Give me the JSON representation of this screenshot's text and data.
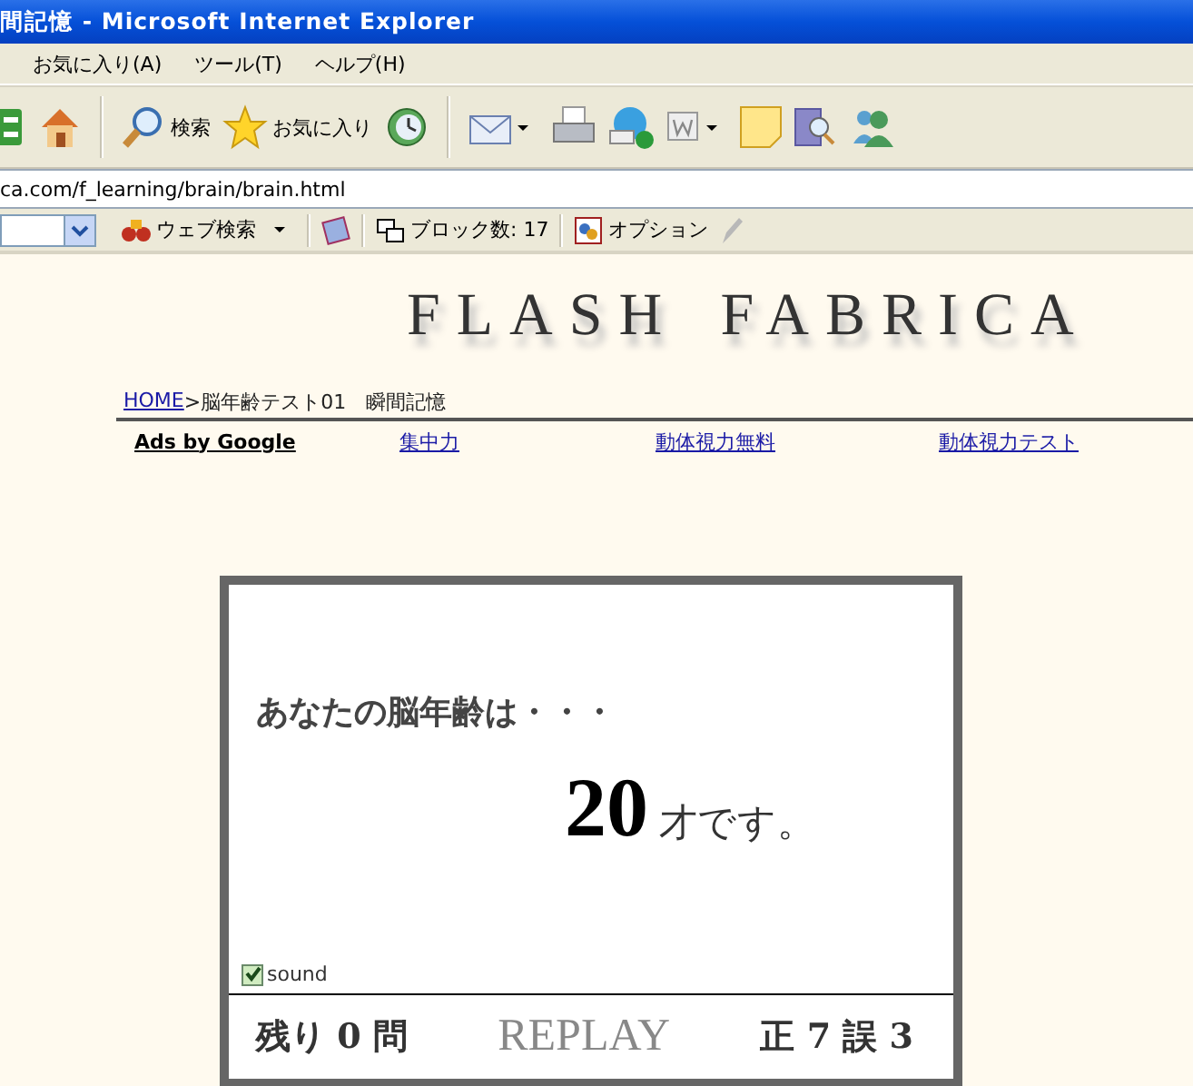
{
  "window": {
    "title": "間記憶 - Microsoft Internet Explorer"
  },
  "menu": [
    "お気に入り(A)",
    "ツール(T)",
    "ヘルプ(H)"
  ],
  "toolbar": [
    {
      "kind": "refresh",
      "dropdown": false
    },
    {
      "kind": "home",
      "dropdown": false
    },
    {
      "kind": "search",
      "label": "検索",
      "dropdown": false
    },
    {
      "kind": "favorites",
      "label": "お気に入り",
      "dropdown": false
    },
    {
      "kind": "history",
      "dropdown": false
    },
    {
      "kind": "mail",
      "dropdown": true
    },
    {
      "kind": "print",
      "dropdown": false
    },
    {
      "kind": "phone",
      "dropdown": false
    },
    {
      "kind": "word",
      "dropdown": true
    },
    {
      "kind": "note",
      "dropdown": false
    },
    {
      "kind": "research",
      "dropdown": false
    },
    {
      "kind": "people",
      "dropdown": false
    }
  ],
  "address": {
    "url": "ca.com/f_learning/brain/brain.html"
  },
  "links_bar": {
    "search_label": "ウェブ検索",
    "block_count": "ブロック数: 17",
    "options": "オプション"
  },
  "page": {
    "logo": "FLASH FABRICA",
    "breadcrumb": {
      "home": "HOME",
      "rest": ">脳年齢テスト01　瞬間記憶"
    },
    "ads": {
      "label": "Ads by Google",
      "links": [
        "集中力",
        "動体視力無料",
        "動体視力テスト"
      ]
    },
    "game": {
      "prompt": "あなたの脳年齢は・・・",
      "age": "20",
      "suffix": "才です。",
      "sound": {
        "label": "sound",
        "checked": true
      },
      "remaining": "残り 0 問",
      "replay": "REPLAY",
      "score": "正 7 誤 3"
    }
  }
}
